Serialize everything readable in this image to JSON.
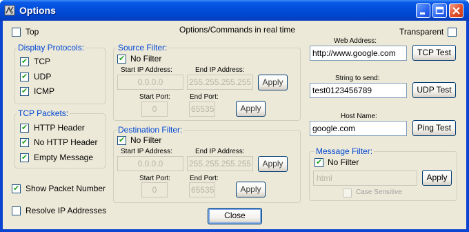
{
  "window": {
    "title": "Options"
  },
  "header": {
    "center_text": "Options/Commands in real time",
    "top_label": "Top",
    "top_checked": false,
    "transparent_label": "Transparent",
    "transparent_checked": false
  },
  "display_protocols": {
    "legend": "Display Protocols:",
    "items": [
      {
        "label": "TCP",
        "checked": true
      },
      {
        "label": "UDP",
        "checked": true
      },
      {
        "label": "ICMP",
        "checked": true
      }
    ]
  },
  "tcp_packets": {
    "legend": "TCP Packets:",
    "items": [
      {
        "label": "HTTP Header",
        "checked": true
      },
      {
        "label": "No HTTP Header",
        "checked": true
      },
      {
        "label": "Empty Message",
        "checked": true
      }
    ]
  },
  "show_packet_number": {
    "label": "Show Packet Number",
    "checked": true
  },
  "resolve_ip": {
    "label": "Resolve IP Addresses",
    "checked": false
  },
  "source_filter": {
    "legend": "Source Filter:",
    "no_filter_label": "No Filter",
    "start_ip_label": "Start IP Address:",
    "end_ip_label": "End IP Address:",
    "start_ip": "0.0.0.0",
    "end_ip": "255.255.255.255",
    "start_port_label": "Start Port:",
    "end_port_label": "End Port:",
    "start_port": "0",
    "end_port": "65535",
    "apply_label": "Apply"
  },
  "destination_filter": {
    "legend": "Destination Filter:",
    "no_filter_label": "No Filter",
    "start_ip_label": "Start IP Address:",
    "end_ip_label": "End IP Address:",
    "start_ip": "0.0.0.0",
    "end_ip": "255.255.255.255",
    "start_port_label": "Start Port:",
    "end_port_label": "End Port:",
    "start_port": "0",
    "end_port": "65535",
    "apply_label": "Apply"
  },
  "web": {
    "label": "Web Address:",
    "value": "http://www.google.com",
    "button": "TCP Test"
  },
  "string_send": {
    "label": "String to send:",
    "value": "test0123456789",
    "button": "UDP Test"
  },
  "host": {
    "label": "Host Name:",
    "value": "google.com",
    "button": "Ping Test"
  },
  "message_filter": {
    "legend": "Message Filter:",
    "no_filter_label": "No Filter",
    "value": "html",
    "apply_label": "Apply",
    "case_label": "Case Sensitive"
  },
  "close_button": "Close",
  "colors": {
    "title_bar": "#0a50dc",
    "face": "#ece9d8",
    "group_text": "#0046d5",
    "check": "#21a121"
  }
}
